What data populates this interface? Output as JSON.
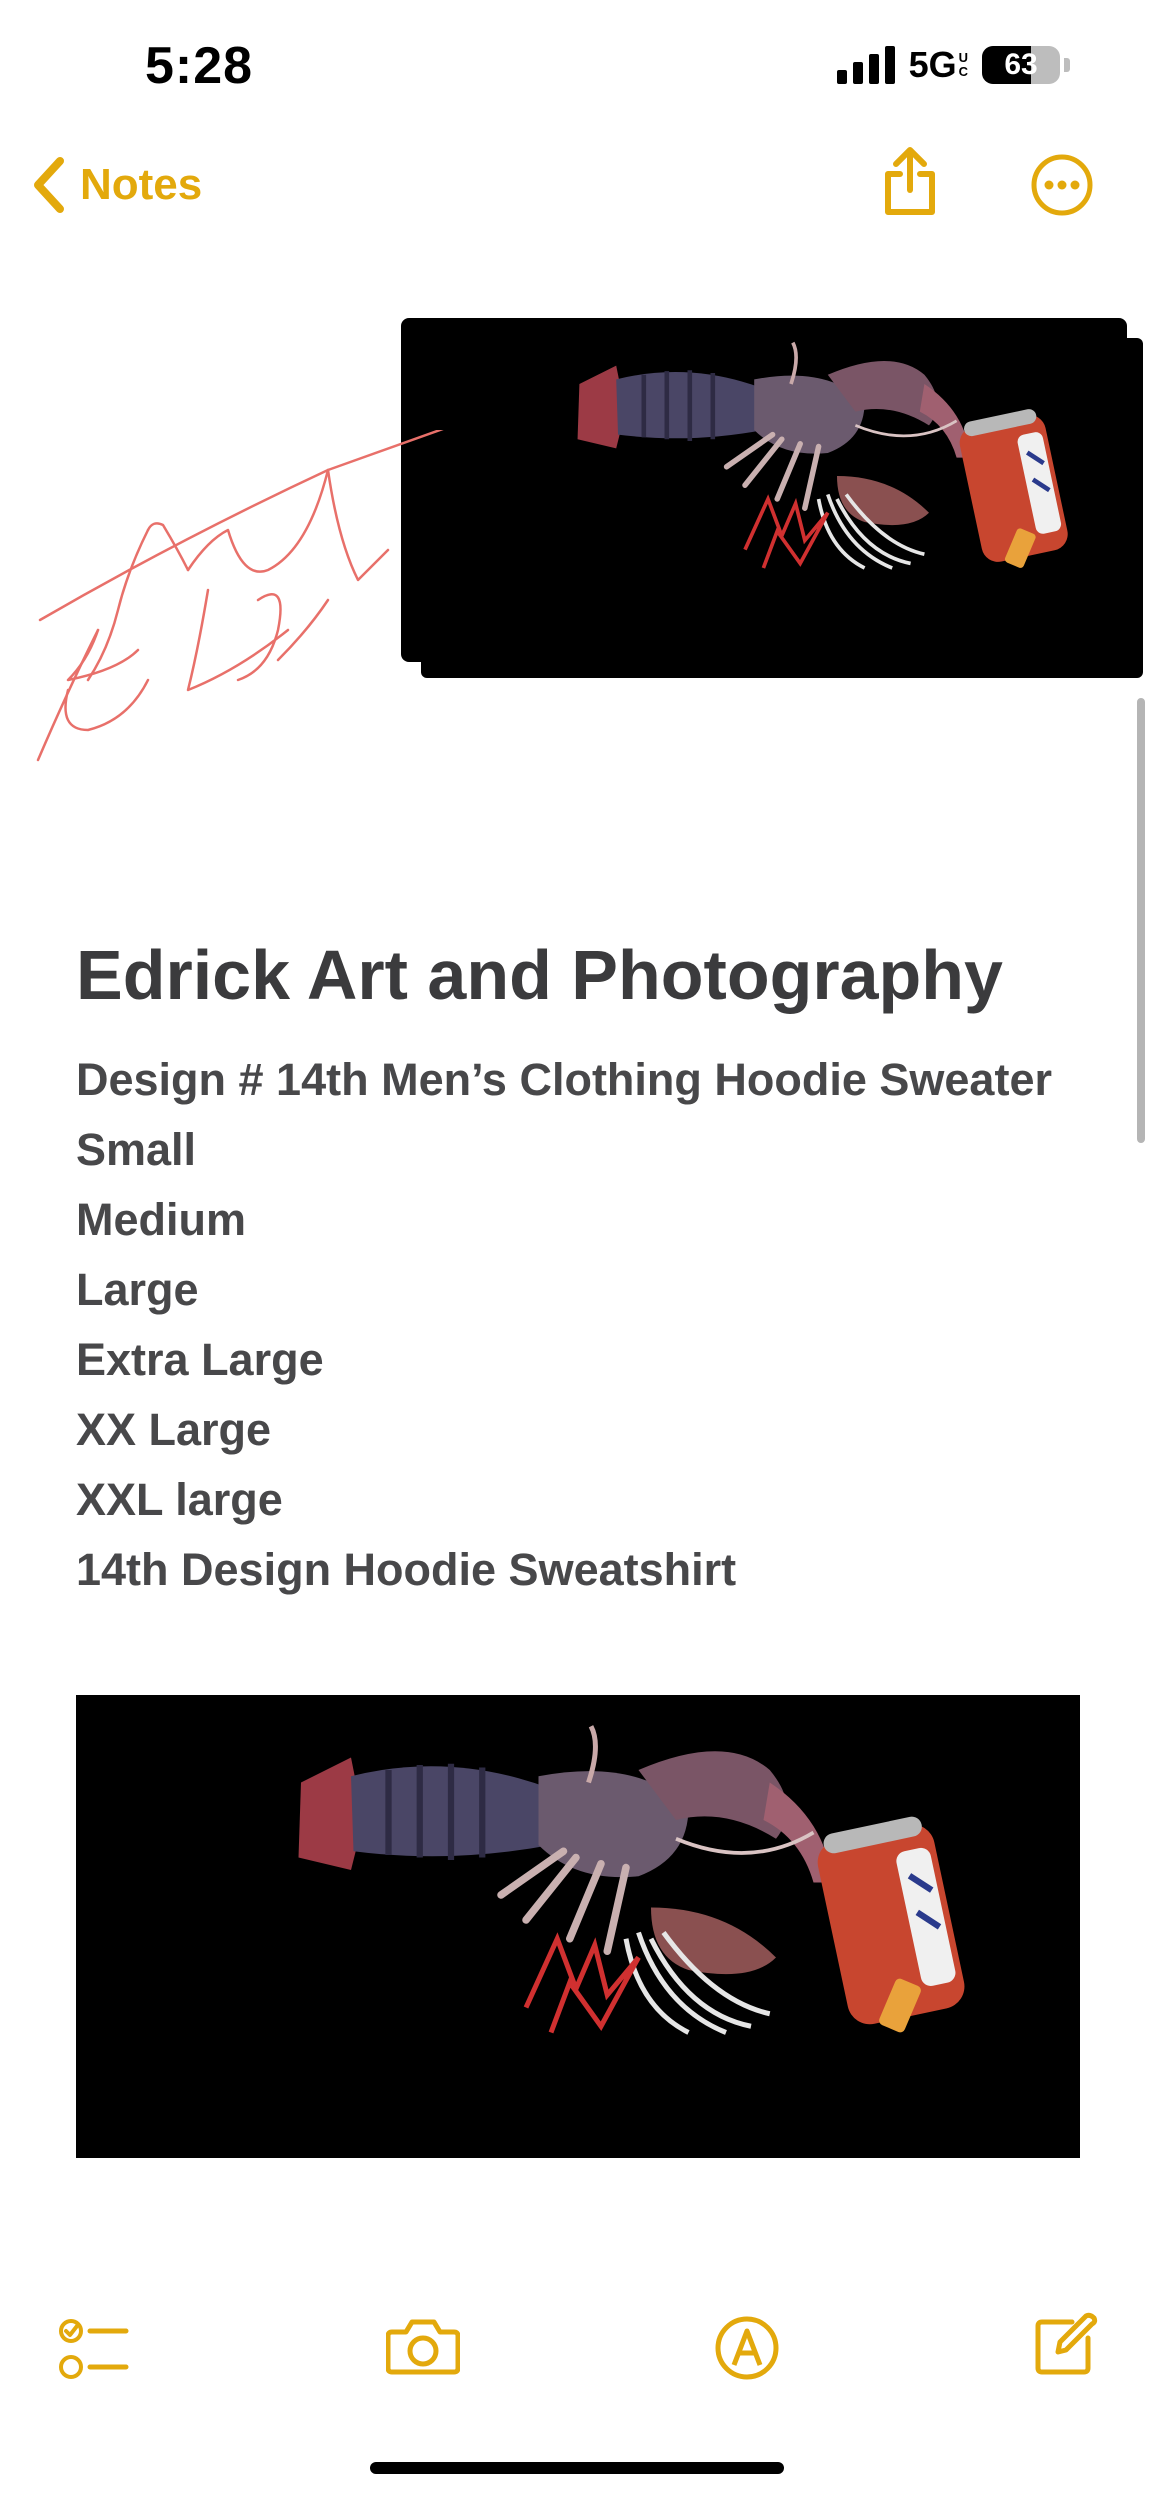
{
  "status_bar": {
    "time": "5:28",
    "network": "5G",
    "network_badge": [
      "U",
      "C"
    ],
    "battery_level": "63",
    "battery_percent": 63,
    "signal_bars": 4
  },
  "nav": {
    "back_label": "Notes",
    "back_icon": "chevron-left-icon",
    "share_icon": "share-icon",
    "more_icon": "ellipsis-circle-icon"
  },
  "note": {
    "title": "Edrick Art and Photography",
    "lines": [
      "Design # 14th Men’s Clothing Hoodie Sweater",
      "Small",
      "Medium",
      "Large",
      "Extra Large",
      "XX Large",
      "XXL large",
      "14th Design Hoodie Sweatshirt"
    ],
    "images": [
      "crayfish-with-beer-can-image",
      "crayfish-with-beer-can-image"
    ],
    "handwriting": "signature-sketch"
  },
  "toolbar": {
    "checklist_icon": "checklist-icon",
    "camera_icon": "camera-icon",
    "markup_icon": "markup-pen-icon",
    "compose_icon": "compose-icon"
  },
  "colors": {
    "accent": "#e3a90c",
    "text": "#3b3b3d",
    "image_background": "#000000",
    "handwriting": "#e8706a"
  }
}
